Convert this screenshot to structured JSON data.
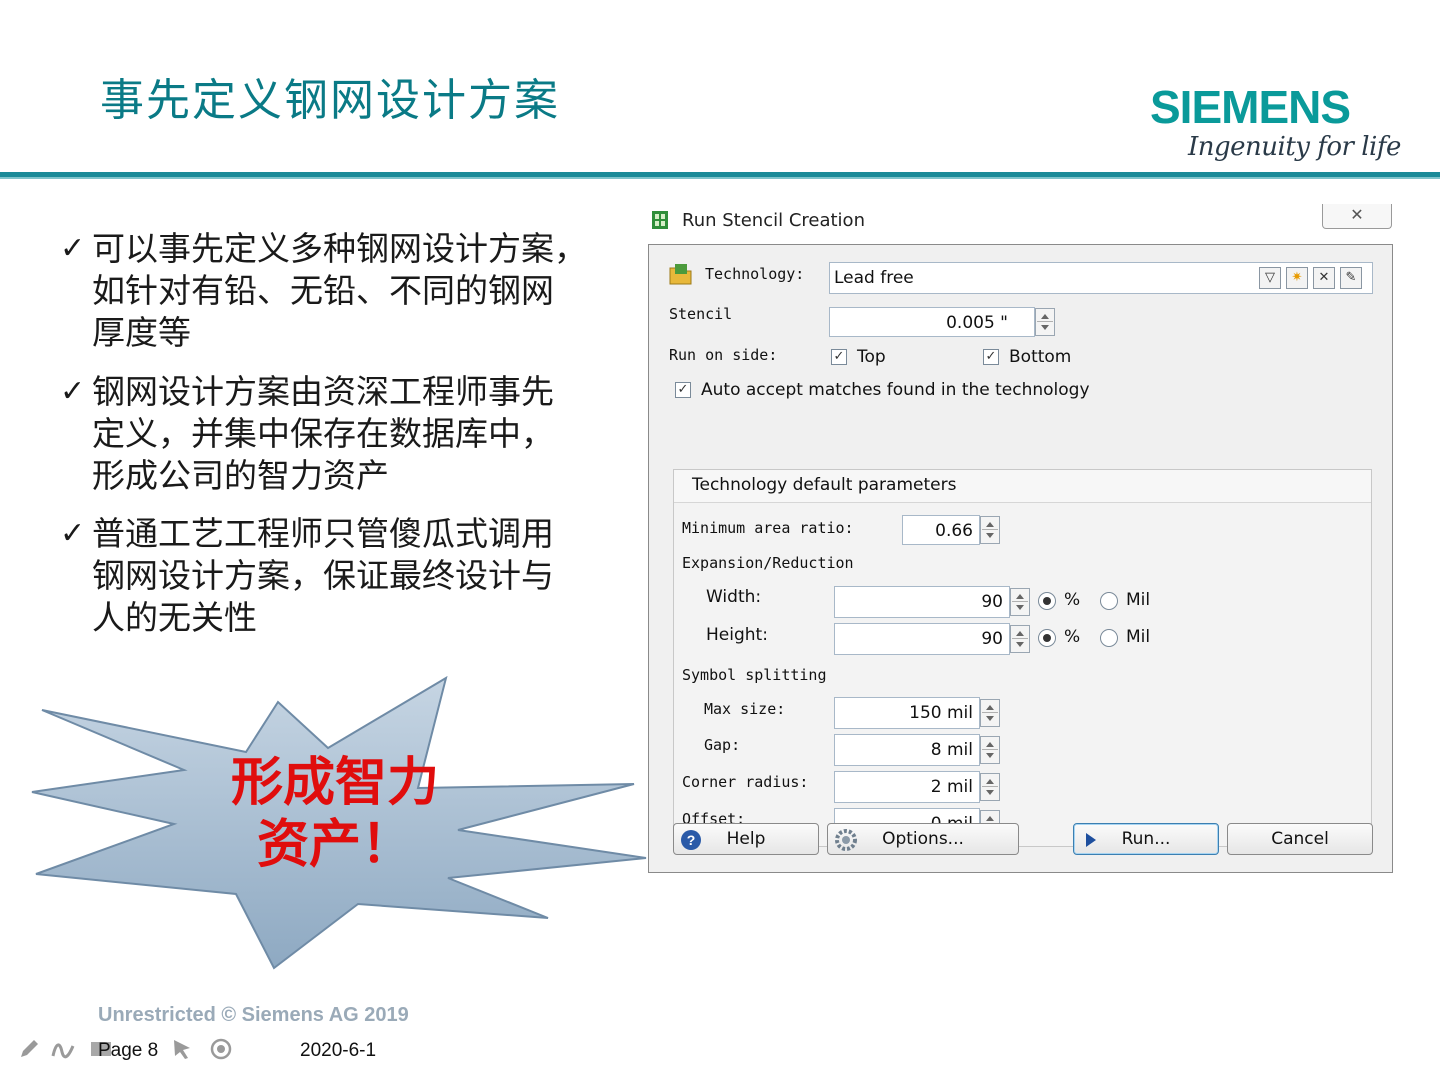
{
  "slide": {
    "title": "事先定义钢网设计方案",
    "brand": "SIEMENS",
    "tagline": "Ingenuity for life",
    "bullets": [
      {
        "mark": "✓",
        "lines": [
          "可以事先定义多种钢网设计方案，",
          "如针对有铅、无铅、不同的钢网",
          "厚度等"
        ]
      },
      {
        "mark": "✓",
        "lines": [
          "钢网设计方案由资深工程师事先",
          "定义，并集中保存在数据库中，",
          "形成公司的智力资产"
        ]
      },
      {
        "mark": "✓",
        "lines": [
          "普通工艺工程师只管傻瓜式调用",
          "钢网设计方案，保证最终设计与",
          "人的无关性"
        ]
      }
    ],
    "callout": {
      "line1": "形成智力",
      "line2": "资产！"
    },
    "footer": {
      "copyright": "Unrestricted © Siemens AG 2019",
      "page": "Page 8",
      "date": "2020-6-1"
    }
  },
  "dialog": {
    "title": "Run Stencil Creation",
    "close_glyph": "✕",
    "technology_label": "Technology:",
    "technology_value": "Lead free",
    "stencil_label": "Stencil",
    "stencil_value": "0.005 \"",
    "run_on_side_label": "Run on side:",
    "top_label": "Top",
    "top_checked": true,
    "bottom_label": "Bottom",
    "bottom_checked": true,
    "auto_accept_label": "Auto accept matches found in the technology",
    "auto_accept_checked": true,
    "group_title": "Technology default parameters",
    "min_area_ratio_label": "Minimum area ratio:",
    "min_area_ratio_value": "0.66",
    "expansion_label": "Expansion/Reduction",
    "width_label": "Width:",
    "width_value": "90",
    "height_label": "Height:",
    "height_value": "90",
    "unit_percent": "%",
    "unit_mil": "Mil",
    "width_unit_selected": "%",
    "height_unit_selected": "%",
    "symbol_splitting_label": "Symbol splitting",
    "max_size_label": "Max size:",
    "max_size_value": "150 mil",
    "gap_label": "Gap:",
    "gap_value": "8 mil",
    "corner_radius_label": "Corner radius:",
    "corner_radius_value": "2 mil",
    "offset_label": "Offset:",
    "offset_value": "0 mil",
    "buttons": {
      "help": "Help",
      "options": "Options...",
      "run": "Run...",
      "cancel": "Cancel"
    }
  },
  "colors": {
    "title_teal": "#0a7a86",
    "brand_teal": "#0a9a9a",
    "callout_red": "#e00d0d",
    "burst_fill": "#a9bed2"
  }
}
